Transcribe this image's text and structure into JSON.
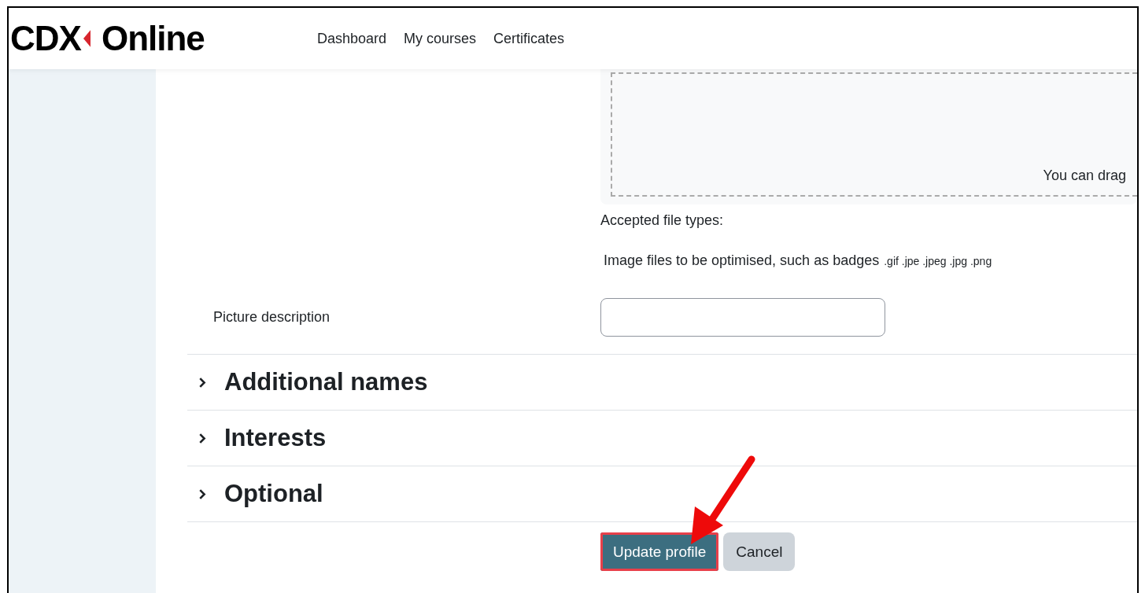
{
  "header": {
    "logo": {
      "left": "CDX",
      "right": "Online"
    },
    "nav": [
      {
        "label": "Dashboard"
      },
      {
        "label": "My courses"
      },
      {
        "label": "Certificates"
      }
    ]
  },
  "dropzone": {
    "hint": "You can drag"
  },
  "accepted": {
    "label": "Accepted file types:",
    "description": "Image files to be optimised, such as badges",
    "extensions": ".gif .jpe .jpeg .jpg .png"
  },
  "picture_description": {
    "label": "Picture description"
  },
  "sections": [
    {
      "title": "Additional names",
      "expanded": false
    },
    {
      "title": "Interests",
      "expanded": false
    },
    {
      "title": "Optional",
      "expanded": false
    }
  ],
  "buttons": [
    {
      "label": "Update profile",
      "kind": "primary",
      "highlighted": true
    },
    {
      "label": "Cancel",
      "kind": "secondary",
      "highlighted": false
    }
  ]
}
